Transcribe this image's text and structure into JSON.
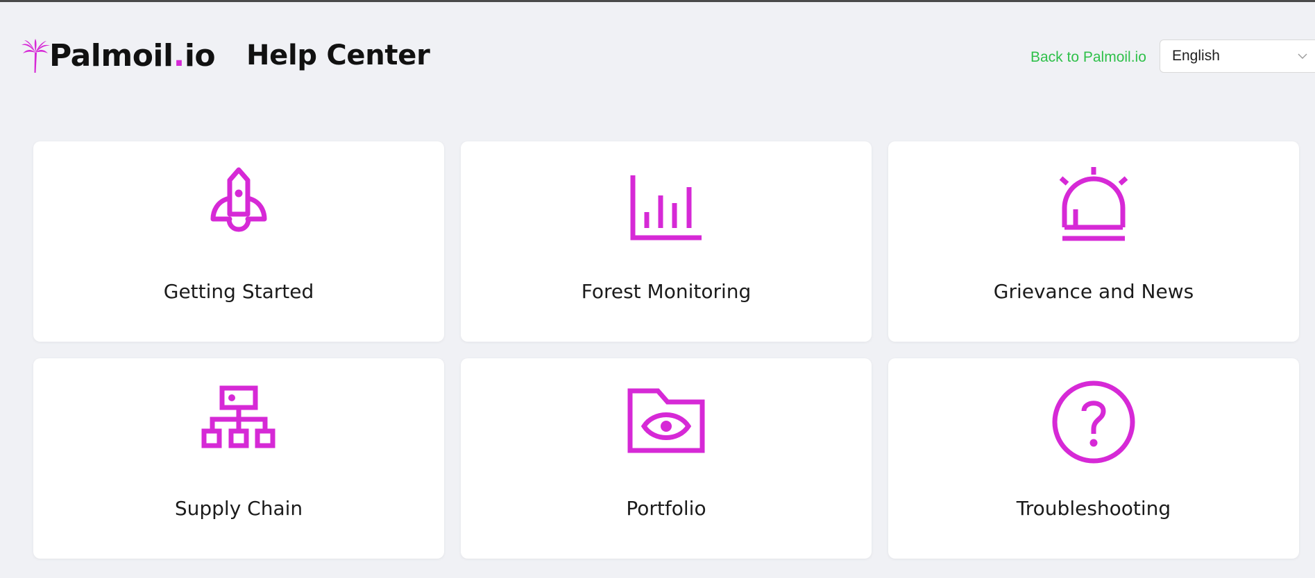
{
  "header": {
    "logo_text_main": "Palmoil",
    "logo_text_dot": ".",
    "logo_text_tld": "io",
    "title": "Help Center",
    "back_link": "Back to Palmoil.io",
    "language_selected": "English"
  },
  "colors": {
    "accent": "#d629d6",
    "link": "#2fc04a",
    "background": "#f0f1f5",
    "card": "#ffffff"
  },
  "categories": [
    {
      "label": "Getting Started",
      "icon": "rocket-icon"
    },
    {
      "label": "Forest Monitoring",
      "icon": "bar-chart-icon"
    },
    {
      "label": "Grievance and News",
      "icon": "alarm-siren-icon"
    },
    {
      "label": "Supply Chain",
      "icon": "hierarchy-icon"
    },
    {
      "label": "Portfolio",
      "icon": "folder-eye-icon"
    },
    {
      "label": "Troubleshooting",
      "icon": "question-circle-icon"
    }
  ]
}
